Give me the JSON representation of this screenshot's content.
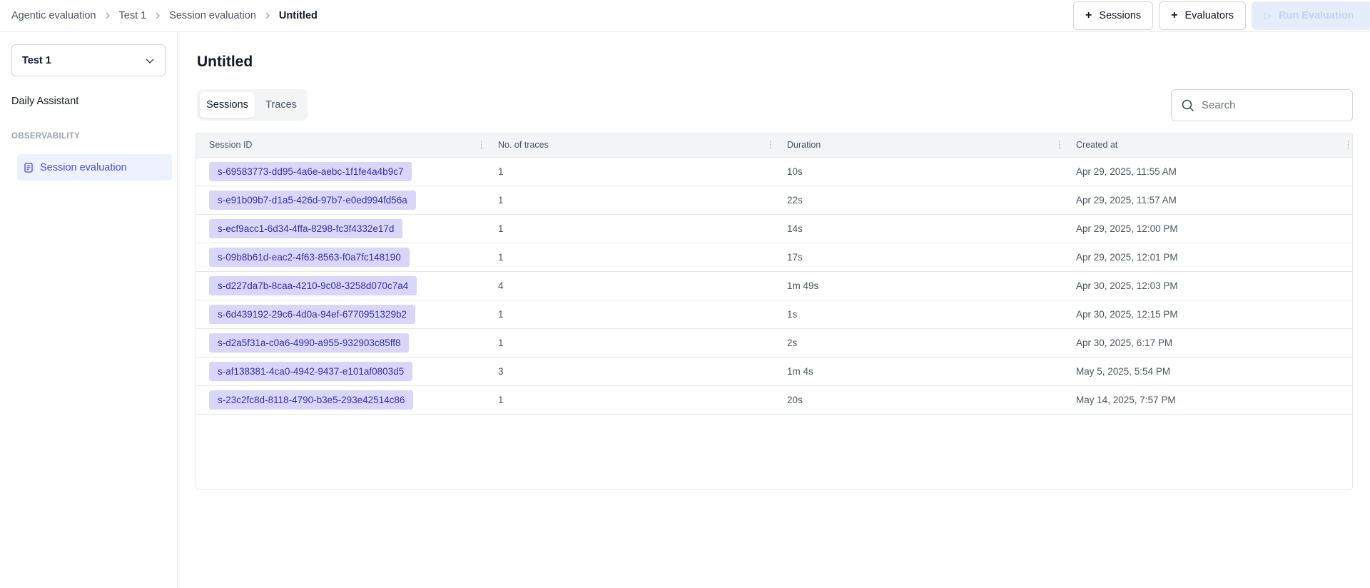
{
  "breadcrumb": {
    "items": [
      "Agentic evaluation",
      "Test 1",
      "Session evaluation"
    ],
    "current": "Untitled"
  },
  "header": {
    "sessions_button": "Sessions",
    "evaluators_button": "Evaluators",
    "run_button": "Run Evaluation"
  },
  "sidebar": {
    "project": "Test 1",
    "agent": "Daily Assistant",
    "section": "OBSERVABILITY",
    "nav_item": "Session evaluation"
  },
  "main": {
    "title": "Untitled",
    "tabs": [
      "Sessions",
      "Traces"
    ],
    "search_placeholder": "Search"
  },
  "table": {
    "columns": [
      "Session ID",
      "No. of traces",
      "Duration",
      "Created at"
    ],
    "rows": [
      {
        "id": "s-69583773-dd95-4a6e-aebc-1f1fe4a4b9c7",
        "traces": "1",
        "duration": "10s",
        "created": "Apr 29, 2025, 11:55 AM"
      },
      {
        "id": "s-e91b09b7-d1a5-426d-97b7-e0ed994fd56a",
        "traces": "1",
        "duration": "22s",
        "created": "Apr 29, 2025, 11:57 AM"
      },
      {
        "id": "s-ecf9acc1-6d34-4ffa-8298-fc3f4332e17d",
        "traces": "1",
        "duration": "14s",
        "created": "Apr 29, 2025, 12:00 PM"
      },
      {
        "id": "s-09b8b61d-eac2-4f63-8563-f0a7fc148190",
        "traces": "1",
        "duration": "17s",
        "created": "Apr 29, 2025, 12:01 PM"
      },
      {
        "id": "s-d227da7b-8caa-4210-9c08-3258d070c7a4",
        "traces": "4",
        "duration": "1m 49s",
        "created": "Apr 30, 2025, 12:03 PM"
      },
      {
        "id": "s-6d439192-29c6-4d0a-94ef-6770951329b2",
        "traces": "1",
        "duration": "1s",
        "created": "Apr 30, 2025, 12:15 PM"
      },
      {
        "id": "s-d2a5f31a-c0a6-4990-a955-932903c85ff8",
        "traces": "1",
        "duration": "2s",
        "created": "Apr 30, 2025, 6:17 PM"
      },
      {
        "id": "s-af138381-4ca0-4942-9437-e101af0803d5",
        "traces": "3",
        "duration": "1m 4s",
        "created": "May 5, 2025, 5:54 PM"
      },
      {
        "id": "s-23c2fc8d-8118-4790-b3e5-293e42514c86",
        "traces": "1",
        "duration": "20s",
        "created": "May 14, 2025, 7:57 PM"
      }
    ]
  }
}
